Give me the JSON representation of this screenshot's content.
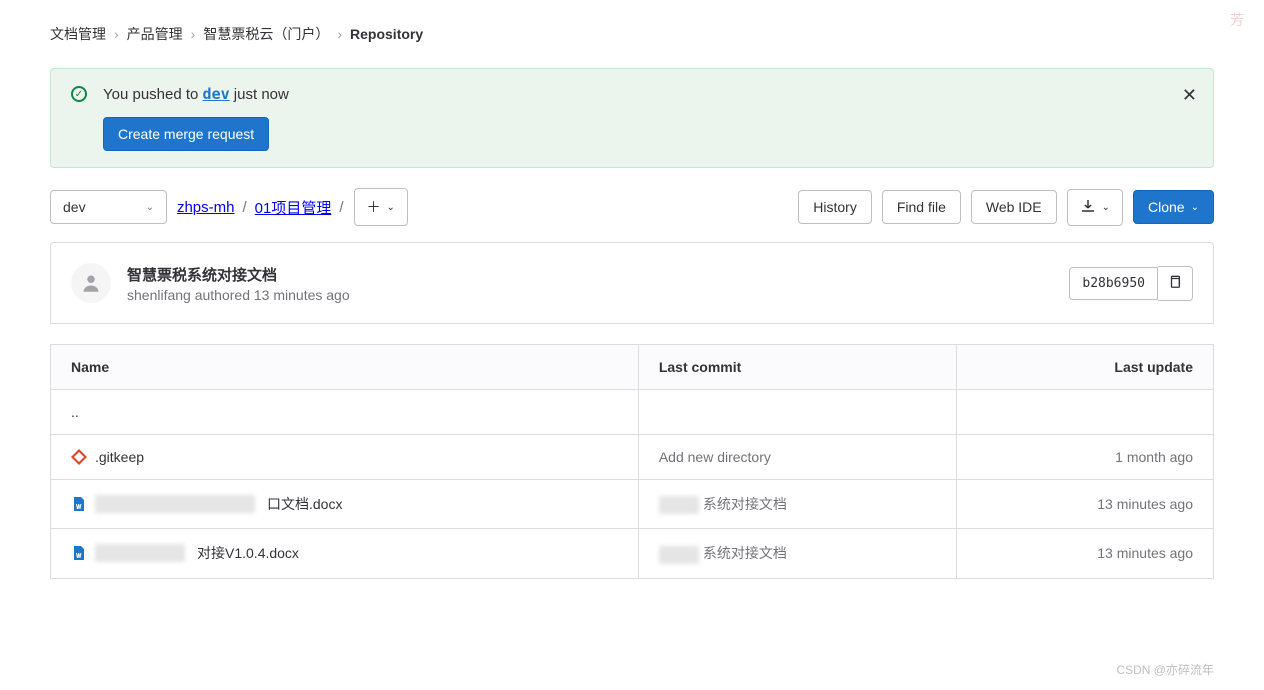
{
  "breadcrumb": [
    "文档管理",
    "产品管理",
    "智慧票税云（门户）",
    "Repository"
  ],
  "alert": {
    "prefix": "You pushed to ",
    "branch": "dev",
    "suffix": " just now",
    "button": "Create merge request"
  },
  "branch_selector": "dev",
  "path": [
    "zhps-mh",
    "01项目管理"
  ],
  "actions": {
    "history": "History",
    "find_file": "Find file",
    "web_ide": "Web IDE",
    "clone": "Clone"
  },
  "commit": {
    "title": "智慧票税系统对接文档",
    "author": "shenlifang",
    "verb": "authored",
    "when": "13 minutes ago",
    "sha": "b28b6950"
  },
  "table": {
    "headers": {
      "name": "Name",
      "last_commit": "Last commit",
      "last_update": "Last update"
    },
    "rows": [
      {
        "name": "..",
        "commit": "",
        "when": "",
        "icon": "up"
      },
      {
        "name": ".gitkeep",
        "commit": "Add new directory",
        "when": "1 month ago",
        "icon": "git"
      },
      {
        "name_suffix": "口文档.docx",
        "commit_suffix": "系统对接文档",
        "when": "13 minutes ago",
        "icon": "word",
        "redact_name": 160,
        "redact_commit": 40
      },
      {
        "name_suffix": "对接V1.0.4.docx",
        "commit_suffix": "系统对接文档",
        "when": "13 minutes ago",
        "icon": "word",
        "redact_name": 90,
        "redact_commit": 40
      }
    ]
  },
  "watermark_tr": "芳",
  "footer": "CSDN @亦碎流年"
}
